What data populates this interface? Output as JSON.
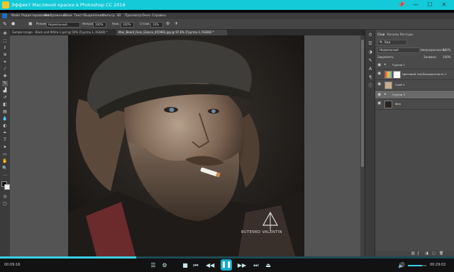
{
  "player": {
    "title": "Эффект Масляной краски в Photoshop CC 2016",
    "time_elapsed": "00:09:16",
    "time_total": "00:29:02",
    "progress": 0.3,
    "colors": {
      "titlebar": "#14c9d8",
      "accent": "#3ad0e3"
    }
  },
  "photoshop": {
    "menu": [
      "Файл",
      "Редактирование",
      "Изображение",
      "Слои",
      "Текст",
      "Выделение",
      "Фильтр",
      "3D",
      "Просмотр",
      "Окно",
      "Справка"
    ],
    "options": {
      "mode_label": "Режим:",
      "mode_value": "Нормальный",
      "opacity_label": "Непрозр.:",
      "opacity_value": "100%",
      "flow_label": "Наж.:",
      "flow_value": "100%",
      "smooth_label": "Сглаж.:",
      "smooth_value": "10%"
    },
    "tabs": [
      "Sample Image - Black and White-1.psd @ 50% (Группа 1, RGB/8) *",
      "Man_Beard_Face_Glance_455983.jpg @ 97,6% (Группа 3, RGB/8) *"
    ],
    "status": {
      "zoom": "97,69%",
      "doc": "Док: 2,89М/23,0М"
    }
  },
  "layers_panel": {
    "tabs": [
      "Слои",
      "Каналы",
      "Контуры"
    ],
    "filter_label": "Вид",
    "blend_mode": "Нормальный",
    "opacity_label": "Непрозрачность:",
    "opacity_value": "100%",
    "lock_label": "Закрепить:",
    "fill_label": "Заливка:",
    "fill_value": "100%",
    "layers": [
      {
        "name": "Группа 1",
        "kind": "group"
      },
      {
        "name": "Цветовой тон/Насыщенность 1",
        "kind": "adjustment"
      },
      {
        "name": "Слой 1",
        "kind": "pixel"
      },
      {
        "name": "Группа 3",
        "kind": "group"
      },
      {
        "name": "Фон",
        "kind": "pixel"
      }
    ]
  },
  "watermark": {
    "text": "BUTENKO VALENTIN"
  }
}
